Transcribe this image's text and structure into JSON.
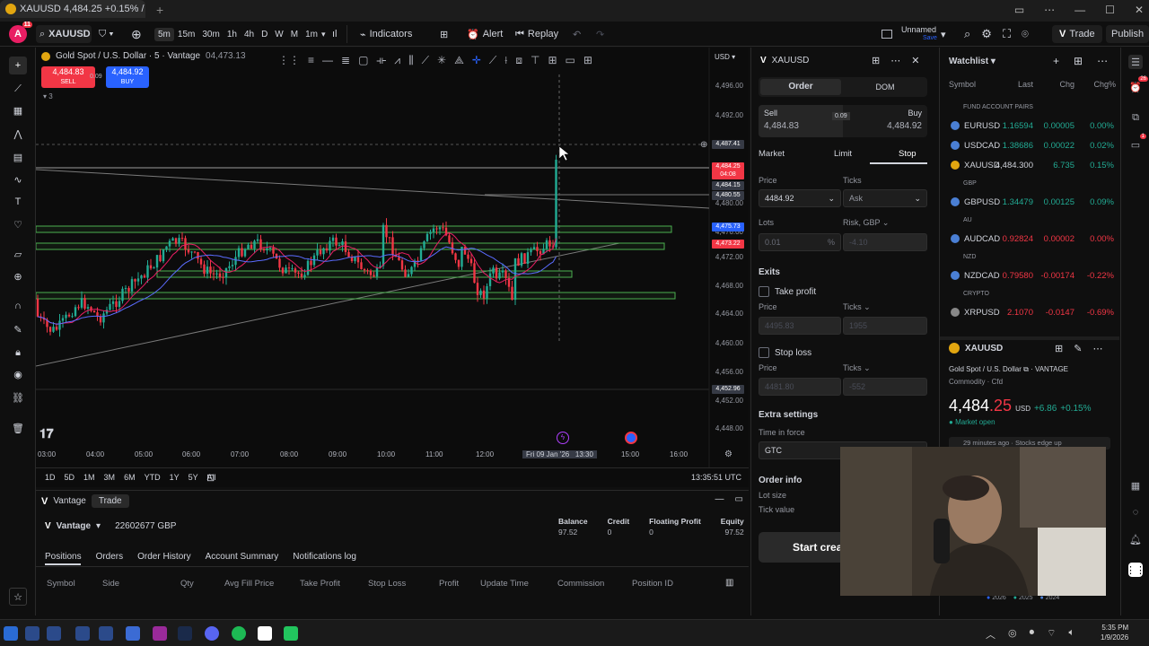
{
  "browser_tab": {
    "title": "XAUUSD 4,484.25 +0.15% / U",
    "new_tab": "+"
  },
  "toolbar": {
    "avatar_letter": "A",
    "avatar_badge": "11",
    "symbol": "XAUUSD",
    "intervals": [
      "5m",
      "15m",
      "30m",
      "1h",
      "4h",
      "D",
      "W",
      "M",
      "1m"
    ],
    "indicators_label": "Indicators",
    "alert_label": "Alert",
    "replay_label": "Replay",
    "layout_name": "Unnamed",
    "layout_status": "Save",
    "trade_label": "Trade",
    "publish_label": "Publish"
  },
  "chart": {
    "legend_title": "Gold Spot / U.S. Dollar · 5 · Vantage",
    "legend_price": "04,473.13",
    "sell_price": "4,484.83",
    "sell_label": "SELL",
    "spread": "0.09",
    "buy_price": "4,484.92",
    "buy_label": "BUY",
    "indicator_count": "3",
    "currency": "USD",
    "price_ticks": [
      "4,496.00",
      "4,492.00",
      "4,488.00",
      "4,484.00",
      "4,480.00",
      "4,476.00",
      "4,472.00",
      "4,468.00",
      "4,464.00",
      "4,460.00",
      "4,456.00",
      "4,452.00",
      "4,448.00"
    ],
    "price_badges": [
      {
        "value": "4,487.41",
        "color": "#363a45"
      },
      {
        "value": "4,484.25",
        "color": "#f23645"
      },
      {
        "value": "04:08",
        "color": "#f23645"
      },
      {
        "value": "4,484.15",
        "color": "#363a45"
      },
      {
        "value": "4,480.55",
        "color": "#363a45"
      },
      {
        "value": "4,475.73",
        "color": "#2962ff"
      },
      {
        "value": "4,473.22",
        "color": "#f23645"
      },
      {
        "value": "4,452.96",
        "color": "#363a45"
      }
    ],
    "time_ticks": [
      "03:00",
      "04:00",
      "05:00",
      "06:00",
      "07:00",
      "08:00",
      "09:00",
      "10:00",
      "11:00",
      "12:00",
      "15:00",
      "16:00"
    ],
    "crosshair_date": "Fri 09 Jan '26",
    "crosshair_time": "13:30",
    "ranges": [
      "1D",
      "5D",
      "1M",
      "3M",
      "6M",
      "YTD",
      "1Y",
      "5Y",
      "All"
    ],
    "clock": "13:35:51 UTC"
  },
  "bottom_panel": {
    "broker": "Vantage",
    "tab_trade": "Trade",
    "account": "22602677 GBP",
    "stats": [
      {
        "label": "Balance",
        "value": "97.52"
      },
      {
        "label": "Credit",
        "value": "0"
      },
      {
        "label": "Floating Profit",
        "value": "0"
      },
      {
        "label": "Equity",
        "value": "97.52"
      }
    ],
    "tabs": [
      "Positions",
      "Orders",
      "Order History",
      "Account Summary",
      "Notifications log"
    ],
    "columns": [
      "Symbol",
      "Side",
      "Qty",
      "Avg Fill Price",
      "Take Profit",
      "Stop Loss",
      "Profit",
      "Update Time",
      "Commission",
      "Position ID"
    ]
  },
  "order_panel": {
    "symbol": "XAUUSD",
    "tab_order": "Order",
    "tab_dom": "DOM",
    "sell_label": "Sell",
    "sell_price": "4,484.83",
    "spread": "0.09",
    "buy_label": "Buy",
    "buy_price": "4,484.92",
    "types": [
      "Market",
      "Limit",
      "Stop"
    ],
    "price_label": "Price",
    "price_value": "4484.92",
    "ticks_label": "Ticks",
    "ticks_value": "Ask",
    "lots_label": "Lots",
    "lots_value": "0.01",
    "lots_pct": "%",
    "risk_label": "Risk, GBP",
    "risk_value": "-4.10",
    "exits_label": "Exits",
    "take_profit_label": "Take profit",
    "tp_price": "4495.83",
    "tp_ticks": "1955",
    "stop_loss_label": "Stop loss",
    "sl_price": "4481.80",
    "sl_ticks": "-552",
    "extra_label": "Extra settings",
    "tif_label": "Time in force",
    "tif_value": "GTC",
    "order_info_label": "Order info",
    "lot_size_label": "Lot size",
    "tick_value_label": "Tick value",
    "start_button": "Start crea"
  },
  "watchlist": {
    "title": "Watchlist",
    "columns": [
      "Symbol",
      "Last",
      "Chg",
      "Chg%"
    ],
    "sections": [
      {
        "name": "FUND ACCOUNT PAIRS",
        "rows": [
          {
            "symbol": "EURUSD",
            "last": "1.16594",
            "chg": "0.00005",
            "chgp": "0.00%",
            "dir": "up",
            "icon_color": "#4a7fd4"
          },
          {
            "symbol": "USDCAD",
            "last": "1.38686",
            "chg": "0.00022",
            "chgp": "0.02%",
            "dir": "up",
            "icon_color": "#4a7fd4"
          },
          {
            "symbol": "XAUUSD",
            "last": "4,484.300",
            "chg": "6.735",
            "chgp": "0.15%",
            "dir": "neutral",
            "icon_color": "#e2a610"
          }
        ]
      },
      {
        "name": "GBP",
        "rows": [
          {
            "symbol": "GBPUSD",
            "last": "1.34479",
            "chg": "0.00125",
            "chgp": "0.09%",
            "dir": "up",
            "icon_color": "#4a7fd4"
          }
        ]
      },
      {
        "name": "AU",
        "rows": [
          {
            "symbol": "AUDCAD",
            "last": "0.92824",
            "chg": "0.00002",
            "chgp": "0.00%",
            "dir": "down",
            "icon_color": "#4a7fd4"
          }
        ]
      },
      {
        "name": "NZD",
        "rows": [
          {
            "symbol": "NZDCAD",
            "last": "0.79580",
            "chg": "-0.00174",
            "chgp": "-0.22%",
            "dir": "down",
            "icon_color": "#4a7fd4"
          }
        ]
      },
      {
        "name": "CRYPTO",
        "rows": [
          {
            "symbol": "XRPUSD",
            "last": "2.1070",
            "chg": "-0.0147",
            "chgp": "-0.69%",
            "dir": "down",
            "icon_color": "#888888"
          }
        ]
      }
    ],
    "detail": {
      "symbol": "XAUUSD",
      "name": "Gold Spot / U.S. Dollar",
      "exchange": "VANTAGE",
      "type": "Commodity · Cfd",
      "price_main": "4,484",
      "price_frac": ".25",
      "currency": "USD",
      "change": "+6.86",
      "change_pct": "+0.15%",
      "status": "Market open",
      "news": "29 minutes ago · Stocks edge up",
      "years": [
        "2026",
        "2025",
        "2024"
      ]
    }
  },
  "rightbar_badges": {
    "alerts": "26",
    "chat": "1"
  },
  "taskbar": {
    "time": "5:35 PM",
    "date": "1/9/2026"
  },
  "colors": {
    "up": "#22ab94",
    "down": "#f23645",
    "accent": "#2962ff",
    "zone": "#4caf50"
  }
}
